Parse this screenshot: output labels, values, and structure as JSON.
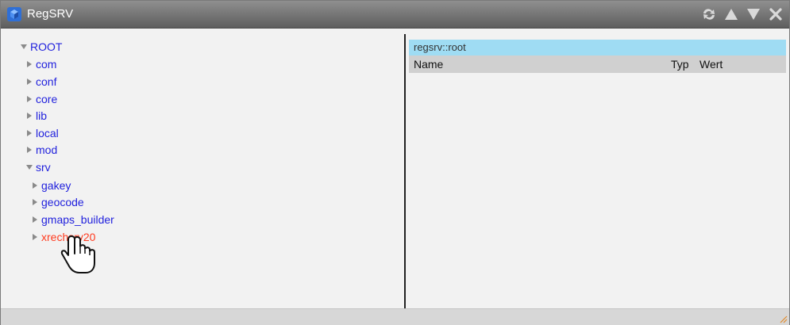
{
  "window": {
    "title": "RegSRV",
    "controls": [
      "refresh-icon",
      "arrow-up-icon",
      "arrow-down-icon",
      "close-icon"
    ]
  },
  "tree": {
    "root_label": "ROOT",
    "items": [
      {
        "label": "com",
        "expanded": false
      },
      {
        "label": "conf",
        "expanded": false
      },
      {
        "label": "core",
        "expanded": false
      },
      {
        "label": "lib",
        "expanded": false
      },
      {
        "label": "local",
        "expanded": false
      },
      {
        "label": "mod",
        "expanded": false
      },
      {
        "label": "srv",
        "expanded": true
      }
    ],
    "srv_children": [
      {
        "label": "gakey",
        "expanded": false
      },
      {
        "label": "geocode",
        "expanded": false
      },
      {
        "label": "gmaps_builder",
        "expanded": false
      },
      {
        "label": "xrechsrv20",
        "expanded": false
      }
    ]
  },
  "detail": {
    "path": "regsrv::root",
    "columns": {
      "name": "Name",
      "typ": "Typ",
      "wert": "Wert"
    }
  },
  "colors": {
    "link": "#2222dd",
    "active_link": "#ff3b1f",
    "path_bar": "#9fdcf3",
    "header_bg": "#d0d0d0",
    "titlebar": "#6e6e6e"
  }
}
